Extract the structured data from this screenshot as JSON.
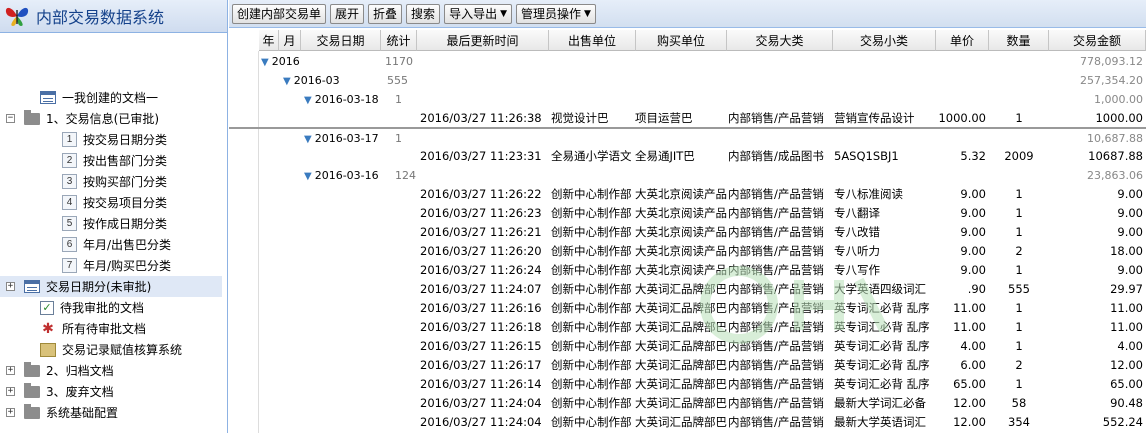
{
  "app": {
    "title": "内部交易数据系统"
  },
  "tree": [
    {
      "label": "一我创建的文档一",
      "icon": "document-icon",
      "level": 1,
      "expander": ""
    },
    {
      "label": "1、交易信息(已审批)",
      "icon": "folder-icon",
      "level": 0,
      "expander": "−"
    },
    {
      "label": "按交易日期分类",
      "icon": "number-icon",
      "num": "1",
      "level": 2,
      "expander": ""
    },
    {
      "label": "按出售部门分类",
      "icon": "number-icon",
      "num": "2",
      "level": 2,
      "expander": ""
    },
    {
      "label": "按购买部门分类",
      "icon": "number-icon",
      "num": "3",
      "level": 2,
      "expander": ""
    },
    {
      "label": "按交易项目分类",
      "icon": "number-icon",
      "num": "4",
      "level": 2,
      "expander": ""
    },
    {
      "label": "按作成日期分类",
      "icon": "number-icon",
      "num": "5",
      "level": 2,
      "expander": ""
    },
    {
      "label": "年月/出售巴分类",
      "icon": "number-icon",
      "num": "6",
      "level": 2,
      "expander": ""
    },
    {
      "label": "年月/购买巴分类",
      "icon": "number-icon",
      "num": "7",
      "level": 2,
      "expander": ""
    },
    {
      "label": "交易日期分(未审批)",
      "icon": "document-icon",
      "level": 0,
      "expander": "+",
      "selected": true
    },
    {
      "label": "待我审批的文档",
      "icon": "check-icon",
      "level": 1,
      "expander": ""
    },
    {
      "label": "所有待审批文档",
      "icon": "star-icon",
      "level": 1,
      "expander": ""
    },
    {
      "label": "交易记录赋值核算系统",
      "icon": "calculator-icon",
      "level": 1,
      "expander": ""
    },
    {
      "label": "2、归档文档",
      "icon": "folder-icon",
      "level": 0,
      "expander": "+"
    },
    {
      "label": "3、废弃文档",
      "icon": "folder-icon",
      "level": 0,
      "expander": "+"
    },
    {
      "label": "系统基础配置",
      "icon": "folder-icon",
      "level": 0,
      "expander": "+"
    }
  ],
  "toolbar": {
    "create": "创建内部交易单",
    "expand": "展开",
    "collapse": "折叠",
    "search": "搜索",
    "import_export": "导入导出",
    "admin": "管理员操作"
  },
  "columns": [
    "年",
    "月",
    "交易日期",
    "统计",
    "最后更新时间",
    "出售单位",
    "购买单位",
    "交易大类",
    "交易小类",
    "单价",
    "数量",
    "交易金额"
  ],
  "groups": [
    {
      "label": "2016",
      "count": "1170",
      "sum": "778,093.12"
    },
    {
      "label": "2016-03",
      "count": "555",
      "sum": "257,354.20"
    },
    {
      "label": "2016-03-18",
      "count": "1",
      "sum": "1,000.00"
    },
    {
      "label": "2016-03-17",
      "count": "1",
      "sum": "10,687.88"
    },
    {
      "label": "2016-03-16",
      "count": "124",
      "sum": "23,863.06"
    }
  ],
  "records": [
    {
      "time": "2016/03/27 11:26:38",
      "seller": "视觉设计巴",
      "buyer": "项目运营巴",
      "cat": "内部销售/产品营销",
      "sub": "营销宣传品设计",
      "price": "1000.00",
      "qty": "1",
      "amount": "1000.00"
    },
    {
      "time": "2016/03/27 11:23:31",
      "seller": "全易通小学语文",
      "buyer": "全易通JIT巴",
      "cat": "内部销售/成品图书",
      "sub": "5ASQ1SBJ1",
      "price": "5.32",
      "qty": "2009",
      "amount": "10687.88"
    },
    {
      "time": "2016/03/27 11:26:22",
      "seller": "创新中心制作部",
      "buyer": "大英北京阅读产品",
      "cat": "内部销售/产品营销",
      "sub": "专八标准阅读",
      "price": "9.00",
      "qty": "1",
      "amount": "9.00"
    },
    {
      "time": "2016/03/27 11:26:23",
      "seller": "创新中心制作部",
      "buyer": "大英北京阅读产品",
      "cat": "内部销售/产品营销",
      "sub": "专八翻译",
      "price": "9.00",
      "qty": "1",
      "amount": "9.00"
    },
    {
      "time": "2016/03/27 11:26:21",
      "seller": "创新中心制作部",
      "buyer": "大英北京阅读产品",
      "cat": "内部销售/产品营销",
      "sub": "专八改错",
      "price": "9.00",
      "qty": "1",
      "amount": "9.00"
    },
    {
      "time": "2016/03/27 11:26:20",
      "seller": "创新中心制作部",
      "buyer": "大英北京阅读产品",
      "cat": "内部销售/产品营销",
      "sub": "专八听力",
      "price": "9.00",
      "qty": "2",
      "amount": "18.00"
    },
    {
      "time": "2016/03/27 11:26:24",
      "seller": "创新中心制作部",
      "buyer": "大英北京阅读产品",
      "cat": "内部销售/产品营销",
      "sub": "专八写作",
      "price": "9.00",
      "qty": "1",
      "amount": "9.00"
    },
    {
      "time": "2016/03/27 11:24:07",
      "seller": "创新中心制作部",
      "buyer": "大英词汇品牌部巴",
      "cat": "内部销售/产品营销",
      "sub": "大学英语四级词汇",
      "price": ".90",
      "qty": "555",
      "amount": "29.97"
    },
    {
      "time": "2016/03/27 11:26:16",
      "seller": "创新中心制作部",
      "buyer": "大英词汇品牌部巴",
      "cat": "内部销售/产品营销",
      "sub": "英专词汇必背 乱序",
      "price": "11.00",
      "qty": "1",
      "amount": "11.00"
    },
    {
      "time": "2016/03/27 11:26:18",
      "seller": "创新中心制作部",
      "buyer": "大英词汇品牌部巴",
      "cat": "内部销售/产品营销",
      "sub": "英专词汇必背 乱序",
      "price": "11.00",
      "qty": "1",
      "amount": "11.00"
    },
    {
      "time": "2016/03/27 11:26:15",
      "seller": "创新中心制作部",
      "buyer": "大英词汇品牌部巴",
      "cat": "内部销售/产品营销",
      "sub": "英专词汇必背 乱序",
      "price": "4.00",
      "qty": "1",
      "amount": "4.00"
    },
    {
      "time": "2016/03/27 11:26:17",
      "seller": "创新中心制作部",
      "buyer": "大英词汇品牌部巴",
      "cat": "内部销售/产品营销",
      "sub": "英专词汇必背 乱序",
      "price": "6.00",
      "qty": "2",
      "amount": "12.00"
    },
    {
      "time": "2016/03/27 11:26:14",
      "seller": "创新中心制作部",
      "buyer": "大英词汇品牌部巴",
      "cat": "内部销售/产品营销",
      "sub": "英专词汇必背 乱序",
      "price": "65.00",
      "qty": "1",
      "amount": "65.00"
    },
    {
      "time": "2016/03/27 11:24:04",
      "seller": "创新中心制作部",
      "buyer": "大英词汇品牌部巴",
      "cat": "内部销售/产品营销",
      "sub": "最新大学词汇必备",
      "price": "12.00",
      "qty": "58",
      "amount": "90.48"
    },
    {
      "time": "2016/03/27 11:24:04",
      "seller": "创新中心制作部",
      "buyer": "大英词汇品牌部巴",
      "cat": "内部销售/产品营销",
      "sub": "最新大学英语词汇",
      "price": "12.00",
      "qty": "354",
      "amount": "552.24"
    }
  ],
  "colors": {
    "accent": "#15428b",
    "header_bg": "#d2dff0",
    "selection": "#dfe8f6",
    "group_triangle": "#3a7bbf"
  }
}
